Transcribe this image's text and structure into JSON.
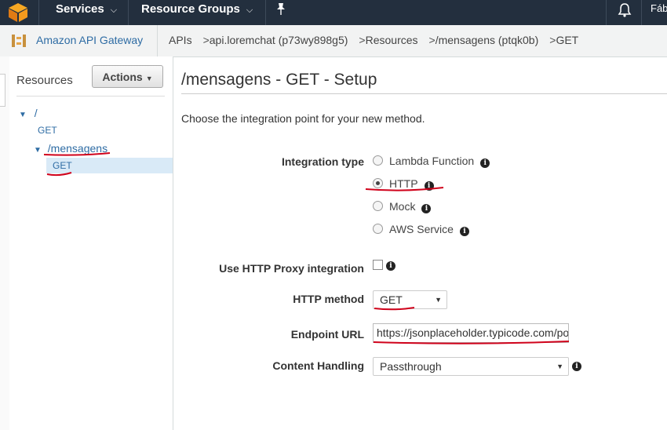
{
  "topnav": {
    "services_label": "Services",
    "resource_groups_label": "Resource Groups",
    "user_label": "Fáb"
  },
  "breadcrumb": {
    "service_name": "Amazon API Gateway",
    "items": [
      "APIs",
      "api.loremchat (p73wy898g5)",
      "Resources",
      "/mensagens (ptqk0b)",
      "GET"
    ],
    "separator": ">"
  },
  "sidebar": {
    "title": "Resources",
    "actions_label": "Actions",
    "tree": [
      {
        "path": "/",
        "methods": [
          "GET"
        ]
      },
      {
        "path": "/mensagens",
        "methods": [
          "GET"
        ]
      }
    ]
  },
  "main": {
    "title": "/mensagens - GET - Setup",
    "intro": "Choose the integration point for your new method.",
    "integration_type": {
      "label": "Integration type",
      "options": [
        "Lambda Function",
        "HTTP",
        "Mock",
        "AWS Service"
      ],
      "selected": "HTTP"
    },
    "proxy": {
      "label": "Use HTTP Proxy integration",
      "checked": false
    },
    "http_method": {
      "label": "HTTP method",
      "value": "GET"
    },
    "endpoint": {
      "label": "Endpoint URL",
      "value": "https://jsonplaceholder.typicode.com/po"
    },
    "content_handling": {
      "label": "Content Handling",
      "value": "Passthrough"
    }
  },
  "colors": {
    "nav_bg": "#232f3e",
    "link": "#2e6ca4",
    "annotation": "#d0021b",
    "selected_row": "#d9eaf7"
  }
}
